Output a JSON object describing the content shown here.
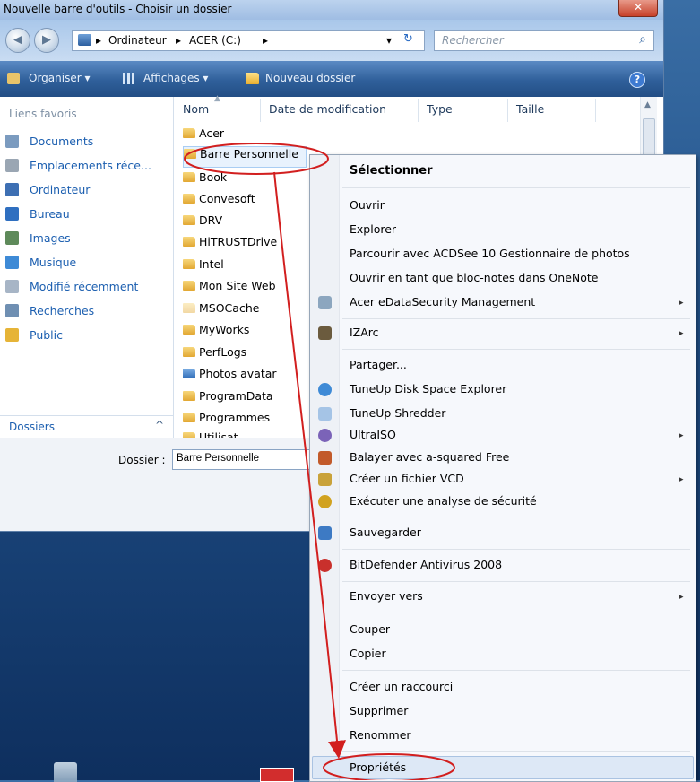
{
  "window": {
    "title": "Nouvelle barre d'outils - Choisir un dossier",
    "close_glyph": "✕"
  },
  "address": {
    "segments": [
      "▸",
      "Ordinateur",
      "▸",
      "ACER (C:)",
      "▸"
    ],
    "dropdown": "▾",
    "refresh": "↻",
    "search_placeholder": "Rechercher",
    "search_glyph": "⌕"
  },
  "toolbar": {
    "organize": "Organiser ▾",
    "views": "Affichages ▾",
    "new_folder": "Nouveau dossier",
    "help": "?"
  },
  "sidebar": {
    "header": "Liens favoris",
    "items": [
      "Documents",
      "Emplacements réce...",
      "Ordinateur",
      "Bureau",
      "Images",
      "Musique",
      "Modifié récemment",
      "Recherches",
      "Public"
    ],
    "folders_label": "Dossiers",
    "folders_chevron": "^"
  },
  "filelist": {
    "columns": [
      "Nom",
      "Date de modification",
      "Type",
      "Taille"
    ],
    "files": [
      "Acer",
      "Barre Personnelle",
      "Book",
      "Convesoft",
      "DRV",
      "HiTRUSTDrive",
      "Intel",
      "Mon Site Web",
      "MSOCache",
      "MyWorks",
      "PerfLogs",
      "Photos avatar",
      "ProgramData",
      "Programmes",
      "Utilisat..."
    ]
  },
  "folder_field": {
    "label": "Dossier :",
    "value": "Barre Personnelle"
  },
  "context_menu": {
    "items": [
      "Sélectionner",
      "Ouvrir",
      "Explorer",
      "Parcourir avec ACDSee 10 Gestionnaire de photos",
      "Ouvrir en tant que bloc-notes dans OneNote",
      "Acer eDataSecurity Management",
      "IZArc",
      "Partager...",
      "TuneUp Disk Space Explorer",
      "TuneUp Shredder",
      "UltraISO",
      "Balayer avec a-squared Free",
      "Créer un fichier VCD",
      "Exécuter une analyse de sécurité",
      "Sauvegarder",
      "BitDefender Antivirus 2008",
      "Envoyer vers",
      "Couper",
      "Copier",
      "Créer un raccourci",
      "Supprimer",
      "Renommer",
      "Propriétés"
    ],
    "submenu_arrow": "▸"
  },
  "colors": {
    "annotation": "#d21f1f",
    "accent": "#1c5fb0"
  }
}
